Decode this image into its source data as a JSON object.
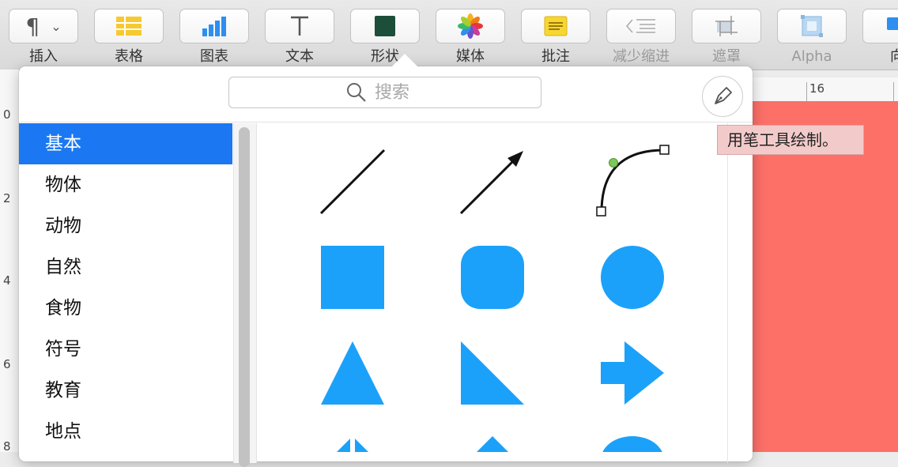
{
  "toolbar": {
    "items": [
      {
        "label": "插入",
        "icon": "paragraph-icon"
      },
      {
        "label": "表格",
        "icon": "table-icon"
      },
      {
        "label": "图表",
        "icon": "chart-icon"
      },
      {
        "label": "文本",
        "icon": "text-icon"
      },
      {
        "label": "形状",
        "icon": "shape-icon"
      },
      {
        "label": "媒体",
        "icon": "media-icon"
      },
      {
        "label": "批注",
        "icon": "comment-icon"
      },
      {
        "label": "减少缩进",
        "icon": "decrease-indent-icon"
      },
      {
        "label": "遮罩",
        "icon": "mask-icon"
      },
      {
        "label": "Alpha",
        "icon": "alpha-icon"
      },
      {
        "label": "向",
        "icon": "arrange-icon"
      }
    ],
    "colors": {
      "table": "#f7c931",
      "chart": "#2d8ff0",
      "shape": "#1d4e3a",
      "comment": "#f7d631"
    }
  },
  "popover": {
    "search": {
      "placeholder": "搜索"
    },
    "pen_tooltip": "用笔工具绘制。",
    "categories": [
      "基本",
      "物体",
      "动物",
      "自然",
      "食物",
      "符号",
      "教育",
      "地点"
    ],
    "selected_category": "基本",
    "shape_color": "#1ba1fa",
    "shapes": [
      "line",
      "arrow-line",
      "curve",
      "square",
      "rounded-square",
      "circle",
      "triangle",
      "right-triangle",
      "arrow"
    ]
  },
  "rulers": {
    "left": [
      "0",
      "2",
      "4",
      "6",
      "8"
    ],
    "top": [
      "16"
    ]
  },
  "canvas": {
    "fill": "#fc7068"
  }
}
